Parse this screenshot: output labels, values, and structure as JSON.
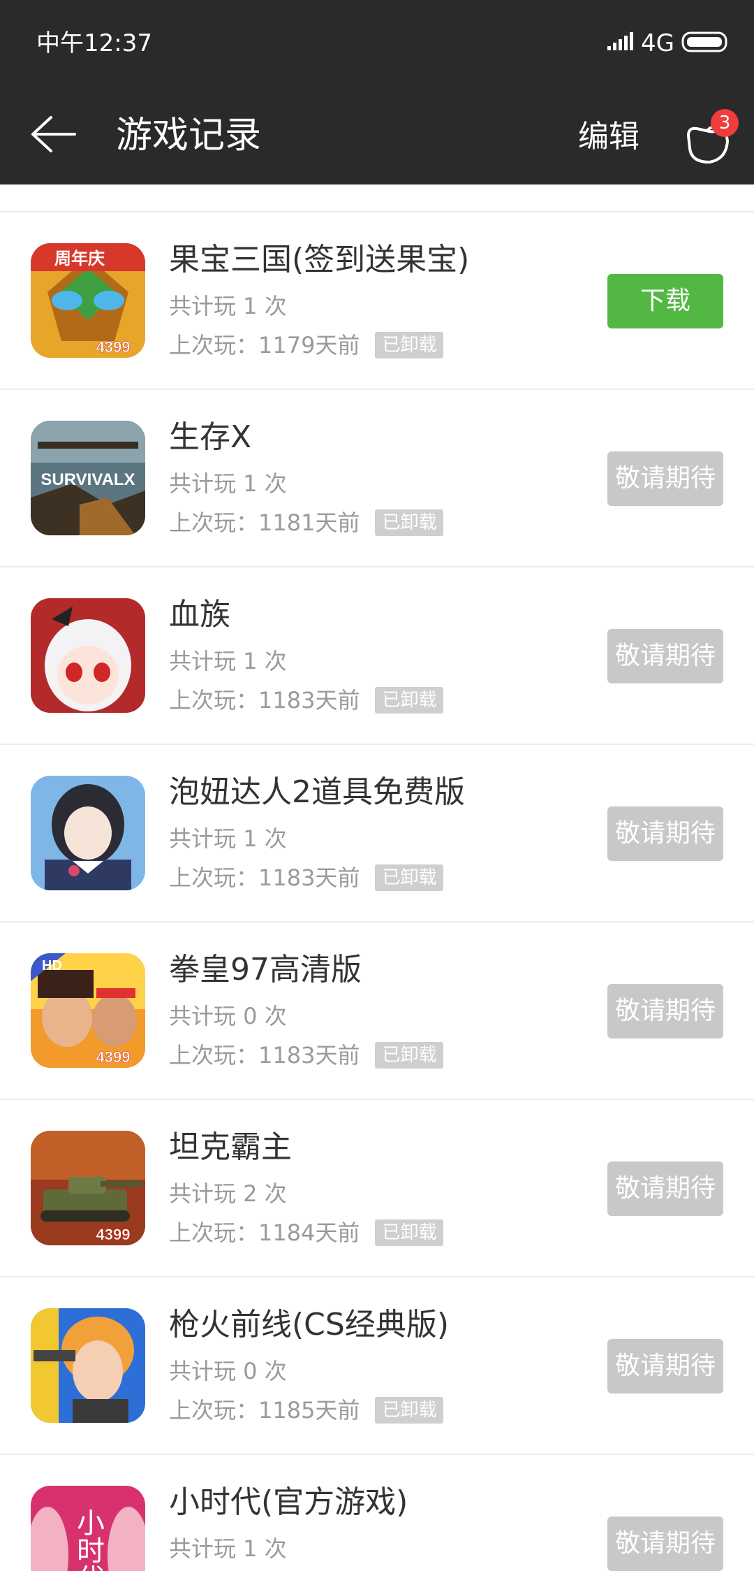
{
  "status_bar": {
    "time": "中午12:37",
    "network": "4G"
  },
  "app_bar": {
    "title": "游戏记录",
    "edit_label": "编辑",
    "gift_badge_count": "3"
  },
  "colors": {
    "topbar": "#2a2a2a",
    "download_button": "#52b843",
    "waiting_button": "#c8c8c8",
    "badge": "#f03c3c"
  },
  "games": [
    {
      "name": "果宝三国(签到送果宝)",
      "play_count": "共计玩 1 次",
      "last_played": "上次玩：1179天前",
      "status_tag": "已卸载",
      "action_label": "下载",
      "action_type": "download",
      "icon": "guobao-sanguo-icon",
      "icon_label": "4399"
    },
    {
      "name": "生存X",
      "play_count": "共计玩 1 次",
      "last_played": "上次玩：1181天前",
      "status_tag": "已卸载",
      "action_label": "敬请期待",
      "action_type": "waiting",
      "icon": "survival-x-icon",
      "icon_label": "SURVIVALX"
    },
    {
      "name": "血族",
      "play_count": "共计玩 1 次",
      "last_played": "上次玩：1183天前",
      "status_tag": "已卸载",
      "action_label": "敬请期待",
      "action_type": "waiting",
      "icon": "xuezu-icon",
      "icon_label": ""
    },
    {
      "name": "泡妞达人2道具免费版",
      "play_count": "共计玩 1 次",
      "last_played": "上次玩：1183天前",
      "status_tag": "已卸载",
      "action_label": "敬请期待",
      "action_type": "waiting",
      "icon": "paoniu-daren-icon",
      "icon_label": ""
    },
    {
      "name": "拳皇97高清版",
      "play_count": "共计玩 0 次",
      "last_played": "上次玩：1183天前",
      "status_tag": "已卸载",
      "action_label": "敬请期待",
      "action_type": "waiting",
      "icon": "kof97-icon",
      "icon_label": "4399"
    },
    {
      "name": "坦克霸主",
      "play_count": "共计玩 2 次",
      "last_played": "上次玩：1184天前",
      "status_tag": "已卸载",
      "action_label": "敬请期待",
      "action_type": "waiting",
      "icon": "tank-icon",
      "icon_label": "4399"
    },
    {
      "name": "枪火前线(CS经典版)",
      "play_count": "共计玩 0 次",
      "last_played": "上次玩：1185天前",
      "status_tag": "已卸载",
      "action_label": "敬请期待",
      "action_type": "waiting",
      "icon": "qianghuo-qianxian-icon",
      "icon_label": ""
    },
    {
      "name": "小时代(官方游戏)",
      "play_count": "共计玩 1 次",
      "last_played": "",
      "status_tag": "",
      "action_label": "敬请期待",
      "action_type": "waiting",
      "icon": "xiaoshidai-icon",
      "icon_label": "小时代"
    }
  ]
}
